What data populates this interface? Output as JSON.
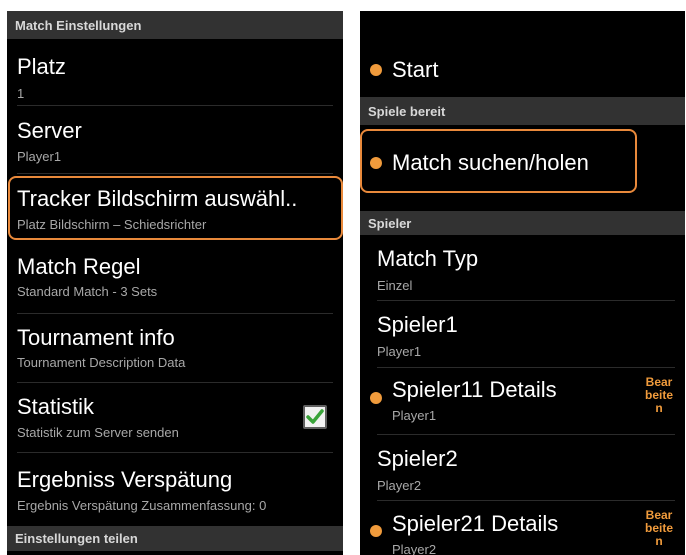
{
  "left": {
    "section_match": "Match Einstellungen",
    "platz": {
      "title": "Platz",
      "value": "1"
    },
    "server": {
      "title": "Server",
      "value": "Player1"
    },
    "tracker": {
      "title": "Tracker Bildschirm auswähl..",
      "value": "Platz Bildschirm – Schiedsrichter"
    },
    "match_regel": {
      "title": "Match Regel",
      "value": "Standard Match - 3 Sets"
    },
    "tournament": {
      "title": "Tournament info",
      "value": "Tournament Description Data"
    },
    "statistik": {
      "title": "Statistik",
      "value": "Statistik zum Server senden",
      "checked": true
    },
    "ergebnis": {
      "title": "Ergebniss Verspätung",
      "value": "Ergebnis Verspätung Zusammenfassung: 0"
    },
    "section_share": "Einstellungen teilen"
  },
  "right": {
    "start": "Start",
    "section_ready": "Spiele bereit",
    "match_suchen": "Match suchen/holen",
    "section_players": "Spieler",
    "match_typ": {
      "title": "Match Typ",
      "value": "Einzel"
    },
    "spieler1": {
      "title": "Spieler1",
      "value": "Player1"
    },
    "spieler11": {
      "title": "Spieler11 Details",
      "value": "Player1",
      "action": "Bearbeiten"
    },
    "spieler2": {
      "title": "Spieler2",
      "value": "Player2"
    },
    "spieler21": {
      "title": "Spieler21 Details",
      "value": "Player2",
      "action": "Bearbeiten"
    }
  },
  "colors": {
    "accent": "#f09b3c",
    "highlight_border": "#e9893b",
    "section_bg": "#323232",
    "check": "#3aa43a"
  },
  "icons": {
    "checkbox": "check-icon",
    "bullet": "status-dot-icon"
  }
}
